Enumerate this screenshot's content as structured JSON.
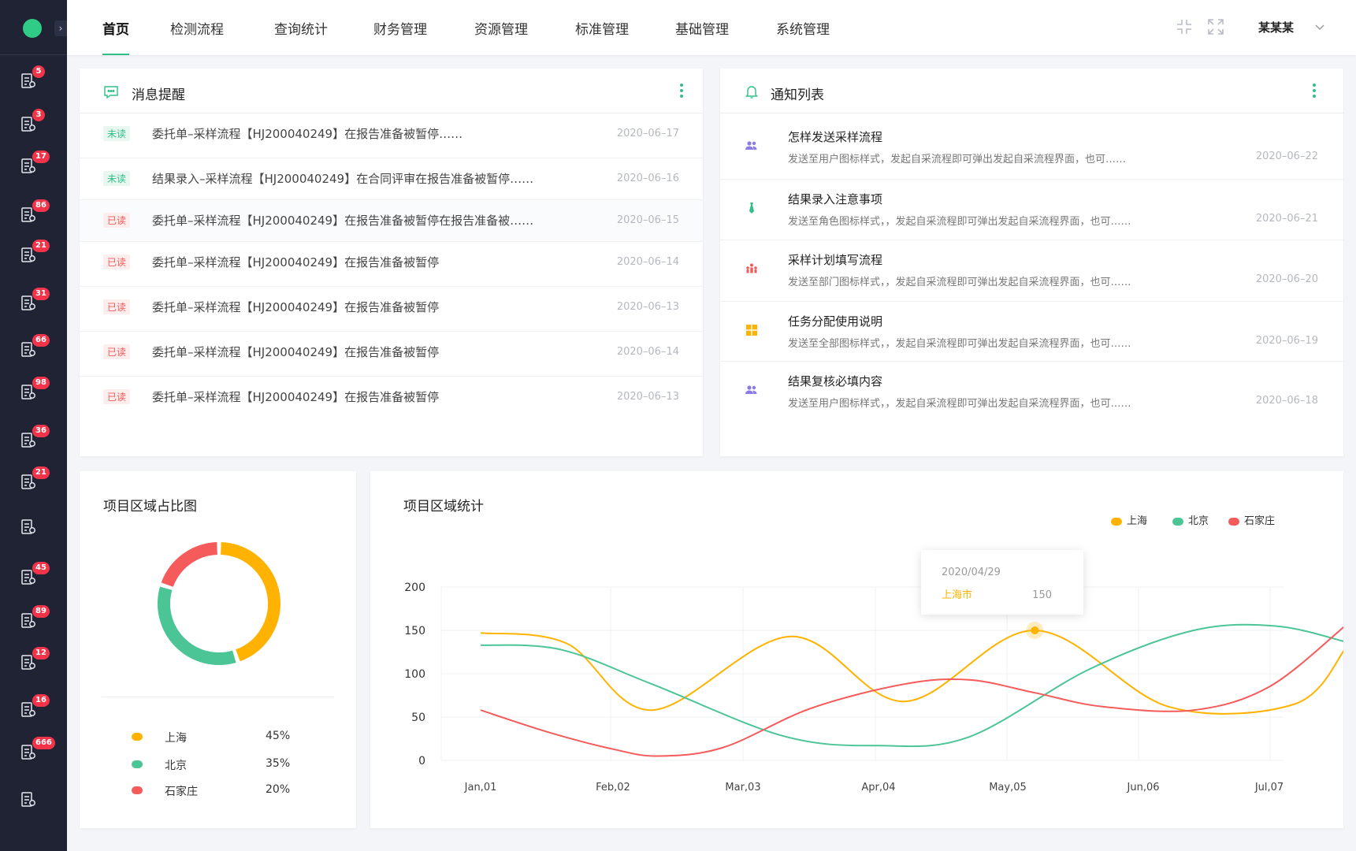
{
  "sidebar": {
    "items": [
      {
        "icon": "report-edit-icon",
        "badge": "5"
      },
      {
        "icon": "cloud-settings-icon",
        "badge": "3"
      },
      {
        "icon": "stamp-icon",
        "badge": "17"
      },
      {
        "icon": "ruler-pencil-icon",
        "badge": "86"
      },
      {
        "icon": "signal-icon",
        "badge": "21"
      },
      {
        "icon": "report-list-icon",
        "badge": "31"
      },
      {
        "icon": "document-icon",
        "badge": "66"
      },
      {
        "icon": "location-icon",
        "badge": "98"
      },
      {
        "icon": "list-settings-icon",
        "badge": "36"
      },
      {
        "icon": "user-doc-icon",
        "badge": "21"
      },
      {
        "icon": "form-edit-icon",
        "badge": ""
      },
      {
        "icon": "factory-icon",
        "badge": "45"
      },
      {
        "icon": "grid-doc-icon",
        "badge": "89"
      },
      {
        "icon": "edit-icon",
        "badge": "12"
      },
      {
        "icon": "clipboard-edit-icon",
        "badge": "16"
      },
      {
        "icon": "list-check-icon",
        "badge": "666"
      },
      {
        "icon": "user-search-icon",
        "badge": ""
      }
    ]
  },
  "nav": {
    "items": [
      "首页",
      "检测流程",
      "查询统计",
      "财务管理",
      "资源管理",
      "标准管理",
      "基础管理",
      "系统管理"
    ],
    "user": "某某某"
  },
  "messages": {
    "title": "消息提醒",
    "rows": [
      {
        "status": "未读",
        "type": "unread",
        "text": "委托单–采样流程【HJ200040249】在报告准备被暂停……",
        "date": "2020–06–17"
      },
      {
        "status": "未读",
        "type": "unread",
        "text": "结果录入–采样流程【HJ200040249】在合同评审在报告准备被暂停……",
        "date": "2020–06–16"
      },
      {
        "status": "已读",
        "type": "read",
        "text": "委托单–采样流程【HJ200040249】在报告准备被暂停在报告准备被……",
        "date": "2020–06–15"
      },
      {
        "status": "已读",
        "type": "read",
        "text": "委托单–采样流程【HJ200040249】在报告准备被暂停",
        "date": "2020–06–14"
      },
      {
        "status": "已读",
        "type": "read",
        "text": "委托单–采样流程【HJ200040249】在报告准备被暂停",
        "date": "2020–06–13"
      },
      {
        "status": "已读",
        "type": "read",
        "text": "委托单–采样流程【HJ200040249】在报告准备被暂停",
        "date": "2020–06–14"
      },
      {
        "status": "已读",
        "type": "read",
        "text": "委托单–采样流程【HJ200040249】在报告准备被暂停",
        "date": "2020–06–13"
      }
    ]
  },
  "notices": {
    "title": "通知列表",
    "rows": [
      {
        "icon": "users-icon",
        "color": "#8c7ae6",
        "title": "怎样发送采样流程",
        "desc": "发送至用户图标样式，发起自采流程即可弹出发起自采流程界面，也可……",
        "date": "2020–06–22"
      },
      {
        "icon": "tie-icon",
        "color": "#2fbf87",
        "title": "结果录入注意事项",
        "desc": "发送至角色图标样式，，发起自采流程即可弹出发起自采流程界面，也可……",
        "date": "2020–06–21"
      },
      {
        "icon": "department-icon",
        "color": "#f05a5a",
        "title": "采样计划填写流程",
        "desc": "发送至部门图标样式，，发起自采流程即可弹出发起自采流程界面，也可……",
        "date": "2020–06–20"
      },
      {
        "icon": "grid-all-icon",
        "color": "#ffb300",
        "title": "任务分配使用说明",
        "desc": "发送至全部图标样式，，发起自采流程即可弹出发起自采流程界面，也可……",
        "date": "2020–06–19"
      },
      {
        "icon": "users-icon",
        "color": "#8c7ae6",
        "title": "结果复核必填内容",
        "desc": "发送至用户图标样式，，发起自采流程即可弹出发起自采流程界面，也可……",
        "date": "2020–06–18"
      }
    ]
  },
  "colors": {
    "shanghai": "#ffb300",
    "beijing": "#4cc596",
    "shijiazhuang": "#f55b5b",
    "accent": "#2fbf87"
  },
  "chart_data": [
    {
      "type": "pie",
      "title": "项目区域占比图",
      "labels": [
        "上海",
        "北京",
        "石家庄"
      ],
      "values": [
        45,
        35,
        20
      ],
      "display": [
        "45%",
        "35%",
        "20%"
      ]
    },
    {
      "type": "line",
      "title": "项目区域统计",
      "categories": [
        "Jan,01",
        "Feb,02",
        "Mar,03",
        "Apr,04",
        "May,05",
        "Jun,06",
        "Jul,07"
      ],
      "yticks": [
        "200",
        "150",
        "100",
        "50",
        "0"
      ],
      "ylim": [
        0,
        200
      ],
      "series": [
        {
          "name": "上海",
          "points": [
            [
              0.0,
              147
            ],
            [
              0.65,
              135
            ],
            [
              1.3,
              58
            ],
            [
              2.35,
              143
            ],
            [
              3.2,
              68
            ],
            [
              4.2,
              150
            ],
            [
              5.2,
              62
            ],
            [
              6.2,
              65
            ],
            [
              6.6,
              128
            ]
          ]
        },
        {
          "name": "北京",
          "points": [
            [
              0.0,
              133
            ],
            [
              0.6,
              128
            ],
            [
              1.3,
              88
            ],
            [
              2.3,
              28
            ],
            [
              3.0,
              17
            ],
            [
              3.7,
              27
            ],
            [
              4.6,
              105
            ],
            [
              5.4,
              150
            ],
            [
              6.05,
              155
            ],
            [
              6.6,
              137
            ]
          ]
        },
        {
          "name": "石家庄",
          "points": [
            [
              0.0,
              58
            ],
            [
              0.5,
              33
            ],
            [
              1.0,
              13
            ],
            [
              1.35,
              5
            ],
            [
              1.85,
              15
            ],
            [
              2.5,
              60
            ],
            [
              3.2,
              88
            ],
            [
              3.7,
              93
            ],
            [
              4.2,
              78
            ],
            [
              4.7,
              62
            ],
            [
              5.4,
              58
            ],
            [
              6.0,
              85
            ],
            [
              6.6,
              155
            ]
          ]
        }
      ],
      "tooltip": {
        "date": "2020/04/29",
        "label": "上海市",
        "value": "150"
      }
    }
  ]
}
